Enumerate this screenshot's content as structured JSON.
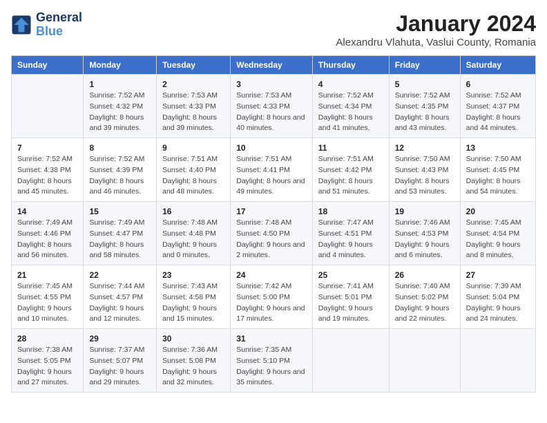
{
  "logo": {
    "line1": "General",
    "line2": "Blue"
  },
  "title": "January 2024",
  "subtitle": "Alexandru Vlahuta, Vaslui County, Romania",
  "days_header": [
    "Sunday",
    "Monday",
    "Tuesday",
    "Wednesday",
    "Thursday",
    "Friday",
    "Saturday"
  ],
  "weeks": [
    [
      {
        "day": "",
        "sunrise": "",
        "sunset": "",
        "daylight": ""
      },
      {
        "day": "1",
        "sunrise": "Sunrise: 7:52 AM",
        "sunset": "Sunset: 4:32 PM",
        "daylight": "Daylight: 8 hours and 39 minutes."
      },
      {
        "day": "2",
        "sunrise": "Sunrise: 7:53 AM",
        "sunset": "Sunset: 4:33 PM",
        "daylight": "Daylight: 8 hours and 39 minutes."
      },
      {
        "day": "3",
        "sunrise": "Sunrise: 7:53 AM",
        "sunset": "Sunset: 4:33 PM",
        "daylight": "Daylight: 8 hours and 40 minutes."
      },
      {
        "day": "4",
        "sunrise": "Sunrise: 7:52 AM",
        "sunset": "Sunset: 4:34 PM",
        "daylight": "Daylight: 8 hours and 41 minutes."
      },
      {
        "day": "5",
        "sunrise": "Sunrise: 7:52 AM",
        "sunset": "Sunset: 4:35 PM",
        "daylight": "Daylight: 8 hours and 43 minutes."
      },
      {
        "day": "6",
        "sunrise": "Sunrise: 7:52 AM",
        "sunset": "Sunset: 4:37 PM",
        "daylight": "Daylight: 8 hours and 44 minutes."
      }
    ],
    [
      {
        "day": "7",
        "sunrise": "Sunrise: 7:52 AM",
        "sunset": "Sunset: 4:38 PM",
        "daylight": "Daylight: 8 hours and 45 minutes."
      },
      {
        "day": "8",
        "sunrise": "Sunrise: 7:52 AM",
        "sunset": "Sunset: 4:39 PM",
        "daylight": "Daylight: 8 hours and 46 minutes."
      },
      {
        "day": "9",
        "sunrise": "Sunrise: 7:51 AM",
        "sunset": "Sunset: 4:40 PM",
        "daylight": "Daylight: 8 hours and 48 minutes."
      },
      {
        "day": "10",
        "sunrise": "Sunrise: 7:51 AM",
        "sunset": "Sunset: 4:41 PM",
        "daylight": "Daylight: 8 hours and 49 minutes."
      },
      {
        "day": "11",
        "sunrise": "Sunrise: 7:51 AM",
        "sunset": "Sunset: 4:42 PM",
        "daylight": "Daylight: 8 hours and 51 minutes."
      },
      {
        "day": "12",
        "sunrise": "Sunrise: 7:50 AM",
        "sunset": "Sunset: 4:43 PM",
        "daylight": "Daylight: 8 hours and 53 minutes."
      },
      {
        "day": "13",
        "sunrise": "Sunrise: 7:50 AM",
        "sunset": "Sunset: 4:45 PM",
        "daylight": "Daylight: 8 hours and 54 minutes."
      }
    ],
    [
      {
        "day": "14",
        "sunrise": "Sunrise: 7:49 AM",
        "sunset": "Sunset: 4:46 PM",
        "daylight": "Daylight: 8 hours and 56 minutes."
      },
      {
        "day": "15",
        "sunrise": "Sunrise: 7:49 AM",
        "sunset": "Sunset: 4:47 PM",
        "daylight": "Daylight: 8 hours and 58 minutes."
      },
      {
        "day": "16",
        "sunrise": "Sunrise: 7:48 AM",
        "sunset": "Sunset: 4:48 PM",
        "daylight": "Daylight: 9 hours and 0 minutes."
      },
      {
        "day": "17",
        "sunrise": "Sunrise: 7:48 AM",
        "sunset": "Sunset: 4:50 PM",
        "daylight": "Daylight: 9 hours and 2 minutes."
      },
      {
        "day": "18",
        "sunrise": "Sunrise: 7:47 AM",
        "sunset": "Sunset: 4:51 PM",
        "daylight": "Daylight: 9 hours and 4 minutes."
      },
      {
        "day": "19",
        "sunrise": "Sunrise: 7:46 AM",
        "sunset": "Sunset: 4:53 PM",
        "daylight": "Daylight: 9 hours and 6 minutes."
      },
      {
        "day": "20",
        "sunrise": "Sunrise: 7:45 AM",
        "sunset": "Sunset: 4:54 PM",
        "daylight": "Daylight: 9 hours and 8 minutes."
      }
    ],
    [
      {
        "day": "21",
        "sunrise": "Sunrise: 7:45 AM",
        "sunset": "Sunset: 4:55 PM",
        "daylight": "Daylight: 9 hours and 10 minutes."
      },
      {
        "day": "22",
        "sunrise": "Sunrise: 7:44 AM",
        "sunset": "Sunset: 4:57 PM",
        "daylight": "Daylight: 9 hours and 12 minutes."
      },
      {
        "day": "23",
        "sunrise": "Sunrise: 7:43 AM",
        "sunset": "Sunset: 4:58 PM",
        "daylight": "Daylight: 9 hours and 15 minutes."
      },
      {
        "day": "24",
        "sunrise": "Sunrise: 7:42 AM",
        "sunset": "Sunset: 5:00 PM",
        "daylight": "Daylight: 9 hours and 17 minutes."
      },
      {
        "day": "25",
        "sunrise": "Sunrise: 7:41 AM",
        "sunset": "Sunset: 5:01 PM",
        "daylight": "Daylight: 9 hours and 19 minutes."
      },
      {
        "day": "26",
        "sunrise": "Sunrise: 7:40 AM",
        "sunset": "Sunset: 5:02 PM",
        "daylight": "Daylight: 9 hours and 22 minutes."
      },
      {
        "day": "27",
        "sunrise": "Sunrise: 7:39 AM",
        "sunset": "Sunset: 5:04 PM",
        "daylight": "Daylight: 9 hours and 24 minutes."
      }
    ],
    [
      {
        "day": "28",
        "sunrise": "Sunrise: 7:38 AM",
        "sunset": "Sunset: 5:05 PM",
        "daylight": "Daylight: 9 hours and 27 minutes."
      },
      {
        "day": "29",
        "sunrise": "Sunrise: 7:37 AM",
        "sunset": "Sunset: 5:07 PM",
        "daylight": "Daylight: 9 hours and 29 minutes."
      },
      {
        "day": "30",
        "sunrise": "Sunrise: 7:36 AM",
        "sunset": "Sunset: 5:08 PM",
        "daylight": "Daylight: 9 hours and 32 minutes."
      },
      {
        "day": "31",
        "sunrise": "Sunrise: 7:35 AM",
        "sunset": "Sunset: 5:10 PM",
        "daylight": "Daylight: 9 hours and 35 minutes."
      },
      {
        "day": "",
        "sunrise": "",
        "sunset": "",
        "daylight": ""
      },
      {
        "day": "",
        "sunrise": "",
        "sunset": "",
        "daylight": ""
      },
      {
        "day": "",
        "sunrise": "",
        "sunset": "",
        "daylight": ""
      }
    ]
  ]
}
